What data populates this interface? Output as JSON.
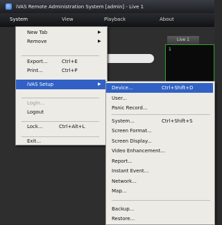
{
  "window": {
    "title": "iVAS Remote Administration System [admin] - Live 1"
  },
  "menubar": {
    "items": [
      "System",
      "View",
      "Playback",
      "About"
    ]
  },
  "live": {
    "tab_label": "Live 1",
    "channel_label": "1"
  },
  "system_menu": [
    {
      "label": "New Tab",
      "shortcut": "",
      "submenu": true,
      "disabled": false,
      "highlighted": false
    },
    {
      "label": "Remove",
      "shortcut": "",
      "submenu": true,
      "disabled": false,
      "highlighted": false
    },
    {
      "label": "Export...",
      "shortcut": "Ctrl+E",
      "submenu": false,
      "disabled": false,
      "highlighted": false
    },
    {
      "label": "Print...",
      "shortcut": "Ctrl+P",
      "submenu": false,
      "disabled": false,
      "highlighted": false
    },
    {
      "label": "iVAS Setup",
      "shortcut": "",
      "submenu": true,
      "disabled": false,
      "highlighted": true
    },
    {
      "label": "Login...",
      "shortcut": "",
      "submenu": false,
      "disabled": true,
      "highlighted": false
    },
    {
      "label": "Logout",
      "shortcut": "",
      "submenu": false,
      "disabled": false,
      "highlighted": false
    },
    {
      "label": "Lock...",
      "shortcut": "Ctrl+Alt+L",
      "submenu": false,
      "disabled": false,
      "highlighted": false
    },
    {
      "label": "Exit...",
      "shortcut": "",
      "submenu": false,
      "disabled": false,
      "highlighted": false
    }
  ],
  "setup_submenu": [
    {
      "label": "Device...",
      "shortcut": "Ctrl+Shift+D",
      "highlighted": true
    },
    {
      "label": "User...",
      "shortcut": "",
      "highlighted": false
    },
    {
      "label": "Panic Record...",
      "shortcut": "",
      "highlighted": false
    },
    {
      "label": "System...",
      "shortcut": "Ctrl+Shift+S",
      "highlighted": false
    },
    {
      "label": "Screen Format...",
      "shortcut": "",
      "highlighted": false
    },
    {
      "label": "Screen Display...",
      "shortcut": "",
      "highlighted": false
    },
    {
      "label": "Video Enhancement...",
      "shortcut": "",
      "highlighted": false
    },
    {
      "label": "Report...",
      "shortcut": "",
      "highlighted": false
    },
    {
      "label": "Instant Event...",
      "shortcut": "",
      "highlighted": false
    },
    {
      "label": "Network...",
      "shortcut": "",
      "highlighted": false
    },
    {
      "label": "Map...",
      "shortcut": "",
      "highlighted": false
    },
    {
      "label": "Backup...",
      "shortcut": "",
      "highlighted": false
    },
    {
      "label": "Restore...",
      "shortcut": "",
      "highlighted": false
    }
  ]
}
